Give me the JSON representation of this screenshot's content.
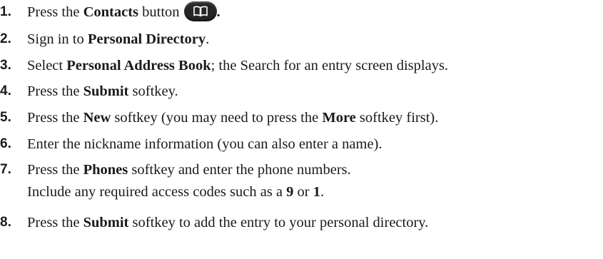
{
  "steps": [
    {
      "number": "1.",
      "p1": "Press the ",
      "b1": "Contacts",
      "p2": " button",
      "p3": "."
    },
    {
      "number": "2.",
      "p1": "Sign in to ",
      "b1": "Personal Directory",
      "p2": "."
    },
    {
      "number": "3.",
      "p1": "Select ",
      "b1": "Personal Address Book",
      "p2": "; the Search for an entry screen displays."
    },
    {
      "number": "4.",
      "p1": "Press the ",
      "b1": "Submit",
      "p2": " softkey."
    },
    {
      "number": "5.",
      "p1": "Press the ",
      "b1": "New",
      "p2": " softkey (you may need to press the ",
      "b2": "More",
      "p3": " softkey first)."
    },
    {
      "number": "6.",
      "p1": "Enter the nickname information (you can also enter a name)."
    },
    {
      "number": "7.",
      "p1": "Press the ",
      "b1": "Phones",
      "p2": " softkey and enter the phone numbers.",
      "cont_p1": "Include any required access codes such as a ",
      "cont_b1": "9",
      "cont_p2": " or ",
      "cont_b2": "1",
      "cont_p3": "."
    },
    {
      "number": "8.",
      "p1": "Press the ",
      "b1": "Submit",
      "p2": " softkey to add the entry to your personal directory."
    }
  ],
  "icons": {
    "contacts_button": "book-icon",
    "button_color": "#262626"
  }
}
